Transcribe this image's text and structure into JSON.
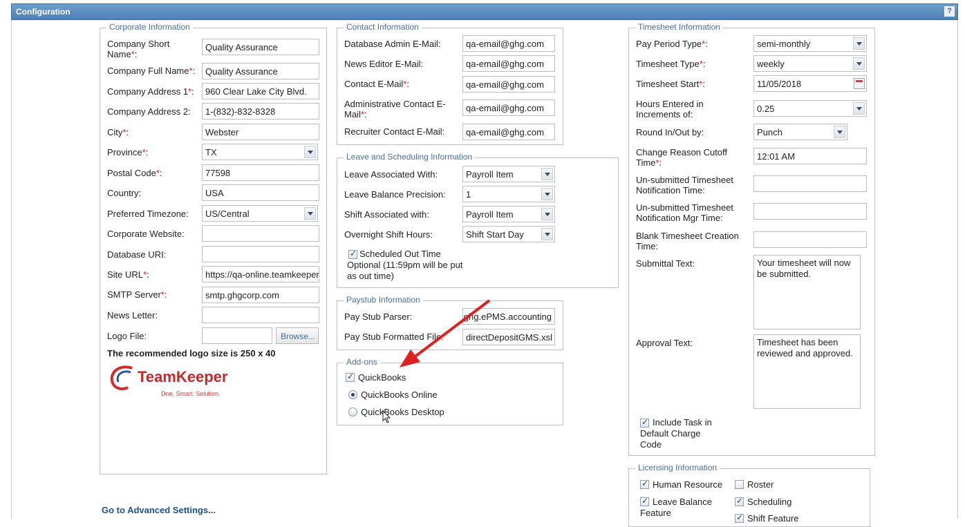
{
  "title": "Configuration",
  "help_label": "?",
  "corporate": {
    "legend": "Corporate Information",
    "company_short_name": {
      "label": "Company Short Name",
      "value": "Quality Assurance"
    },
    "company_full_name": {
      "label": "Company Full Name",
      "value": "Quality Assurance"
    },
    "company_address1": {
      "label": "Company Address 1",
      "value": "960 Clear Lake City Blvd."
    },
    "company_address2": {
      "label": "Company Address 2:",
      "value": "1-(832)-832-8328"
    },
    "city": {
      "label": "City",
      "value": "Webster"
    },
    "province": {
      "label": "Province",
      "value": "TX"
    },
    "postal_code": {
      "label": "Postal Code",
      "value": "77598"
    },
    "country": {
      "label": "Country:",
      "value": "USA"
    },
    "timezone": {
      "label": "Preferred Timezone:",
      "value": "US/Central"
    },
    "website": {
      "label": "Corporate Website:",
      "value": ""
    },
    "database_uri": {
      "label": "Database URI:",
      "value": ""
    },
    "site_url": {
      "label": "Site URL",
      "value": "https://qa-online.teamkeeper.com"
    },
    "smtp": {
      "label": "SMTP Server",
      "value": "smtp.ghgcorp.com"
    },
    "newsletter": {
      "label": "News Letter:",
      "value": ""
    },
    "logo_file": {
      "label": "Logo File:",
      "value": "",
      "browse_label": "Browse..."
    },
    "logo_note": "The recommended logo size is 250 x 40",
    "logo_text": "TeamKeeper",
    "logo_tagline": "Dne. Smart. Solution."
  },
  "contact": {
    "legend": "Contact Information",
    "db_admin": {
      "label": "Database Admin E-Mail:",
      "value": "qa-email@ghg.com"
    },
    "news_editor": {
      "label": "News Editor E-Mail:",
      "value": "qa-email@ghg.com"
    },
    "contact_email": {
      "label": "Contact E-Mail",
      "value": "qa-email@ghg.com"
    },
    "admin_contact": {
      "label": "Administrative Contact E-Mail",
      "value": "qa-email@ghg.com"
    },
    "recruiter": {
      "label": "Recruiter Contact E-Mail:",
      "value": "qa-email@ghg.com"
    }
  },
  "leave": {
    "legend": "Leave and Scheduling Information",
    "leave_assoc": {
      "label": "Leave Associated With:",
      "value": "Payroll Item"
    },
    "leave_precision": {
      "label": "Leave Balance Precision:",
      "value": "1"
    },
    "shift_assoc": {
      "label": "Shift Associated with:",
      "value": "Payroll Item"
    },
    "overnight": {
      "label": "Overnight Shift Hours:",
      "value": "Shift Start Day"
    },
    "sched_out_optional": "Scheduled Out Time Optional (11:59pm will be put as out time)"
  },
  "paystub": {
    "legend": "Paystub Information",
    "parser": {
      "label": "Pay Stub Parser:",
      "value": "com.ghg.ePMS.accounting"
    },
    "formatted": {
      "label": "Pay Stub Formatted File:",
      "value": "directDepositGMS.xsl"
    }
  },
  "addons": {
    "legend": "Add-ons",
    "quickbooks": "QuickBooks",
    "qb_online": "QuickBooks Online",
    "qb_desktop": "QuickBooks Desktop"
  },
  "timesheet": {
    "legend": "Timesheet Information",
    "pay_period": {
      "label": "Pay Period Type",
      "value": "semi-monthly"
    },
    "ts_type": {
      "label": "Timesheet Type",
      "value": "weekly"
    },
    "ts_start": {
      "label": "Timesheet Start",
      "value": "11/05/2018"
    },
    "increments": {
      "label": "Hours Entered in Increments of:",
      "value": "0.25"
    },
    "round": {
      "label": "Round In/Out by:",
      "value": "Punch"
    },
    "cutoff": {
      "label": "Change Reason Cutoff Time",
      "value": "12:01 AM"
    },
    "unsub_notif": {
      "label": "Un-submitted Timesheet Notification Time:",
      "value": ""
    },
    "unsub_mgr": {
      "label": "Un-submitted Timesheet Notification Mgr Time:",
      "value": ""
    },
    "blank_creation": {
      "label": "Blank Timesheet Creation Time:",
      "value": ""
    },
    "submittal": {
      "label": "Submittal Text:",
      "value": "Your timesheet will now be submitted."
    },
    "approval": {
      "label": "Approval Text:",
      "value": "Timesheet has been reviewed and approved."
    },
    "include_task": "Include Task in Default Charge Code"
  },
  "licensing": {
    "legend": "Licensing Information",
    "human_resource": "Human Resource",
    "roster": "Roster",
    "leave_balance": "Leave Balance Feature",
    "scheduling": "Scheduling",
    "shift_feature": "Shift Feature"
  },
  "advanced_link": "Go to Advanced Settings...",
  "colors": {
    "accent": "#4f80b4",
    "required": "#d02020",
    "arrow": "#e02020",
    "legend": "#4d6f99"
  }
}
